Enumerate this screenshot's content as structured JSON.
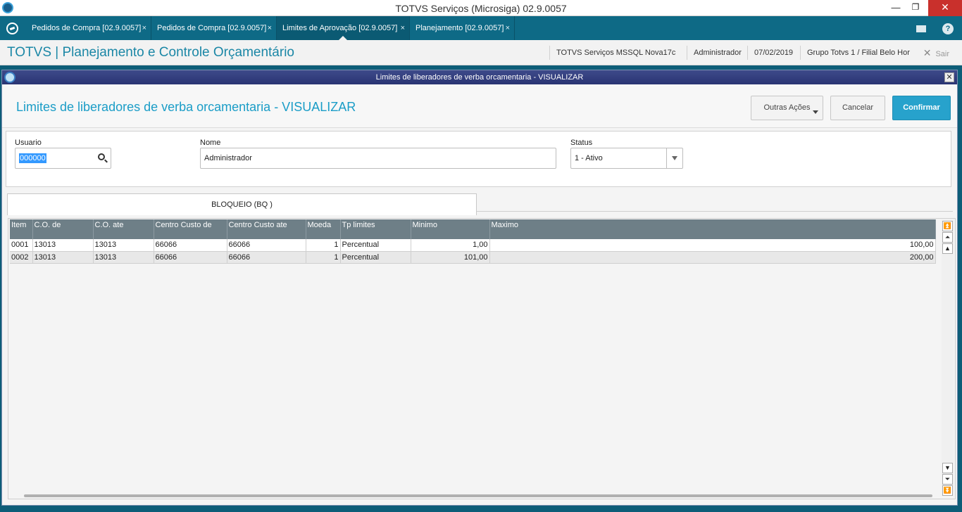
{
  "window": {
    "title": "TOTVS Serviços (Microsiga) 02.9.0057",
    "minimize_glyph": "—",
    "restore_glyph": "❐",
    "close_glyph": "✕"
  },
  "tabs": [
    {
      "label": "Pedidos de Compra [02.9.0057]",
      "close": "×"
    },
    {
      "label": "Pedidos de Compra [02.9.0057]",
      "close": "×"
    },
    {
      "label": "Limites de Aprovação [02.9.0057]",
      "close": "×"
    },
    {
      "label": "Planejamento [02.9.0057]",
      "close": "×"
    }
  ],
  "header": {
    "module_title": "TOTVS | Planejamento e Controle Orçamentário",
    "environment": "TOTVS Serviços MSSQL Nova17c",
    "user": "Administrador",
    "date": "07/02/2019",
    "branch": "Grupo Totvs 1 / Filial Belo Hor",
    "exit_label": "Sair",
    "exit_glyph": "✕",
    "help_glyph": "?"
  },
  "dialog": {
    "caption": "Limites de liberadores de verba orcamentaria - VISUALIZAR",
    "close_glyph": "✕",
    "page_title": "Limites de liberadores de verba orcamentaria - VISUALIZAR",
    "buttons": {
      "other_actions": "Outras Ações",
      "cancel": "Cancelar",
      "confirm": "Confirmar"
    }
  },
  "form": {
    "user_label": "Usuario",
    "user_value": "000000",
    "name_label": "Nome",
    "name_value": "Administrador",
    "status_label": "Status",
    "status_value": "1 - Ativo"
  },
  "folder_tab": "BLOQUEIO (BQ )",
  "grid": {
    "columns": [
      "Item",
      "C.O. de",
      "C.O. ate",
      "Centro Custo de",
      "Centro Custo ate",
      "Moeda",
      "Tp limites",
      "Minimo",
      "Maximo"
    ],
    "rows": [
      [
        "0001",
        "13013",
        "13013",
        "66066",
        "66066",
        "1",
        "Percentual",
        "1,00",
        "100,00"
      ],
      [
        "0002",
        "13013",
        "13013",
        "66066",
        "66066",
        "1",
        "Percentual",
        "101,00",
        "200,00"
      ]
    ]
  },
  "scroll_glyphs": {
    "top": "⏫",
    "page_up": "⏶",
    "up": "▲",
    "down": "▼",
    "page_down": "⏷",
    "bottom": "⏬"
  },
  "colors": {
    "tabstrip": "#0e6a86",
    "accent": "#1b87a6",
    "confirm": "#27a2cc",
    "grid_header": "#6e7f87",
    "dialog_caption": "#2a3473",
    "close_red": "#c9302c"
  }
}
